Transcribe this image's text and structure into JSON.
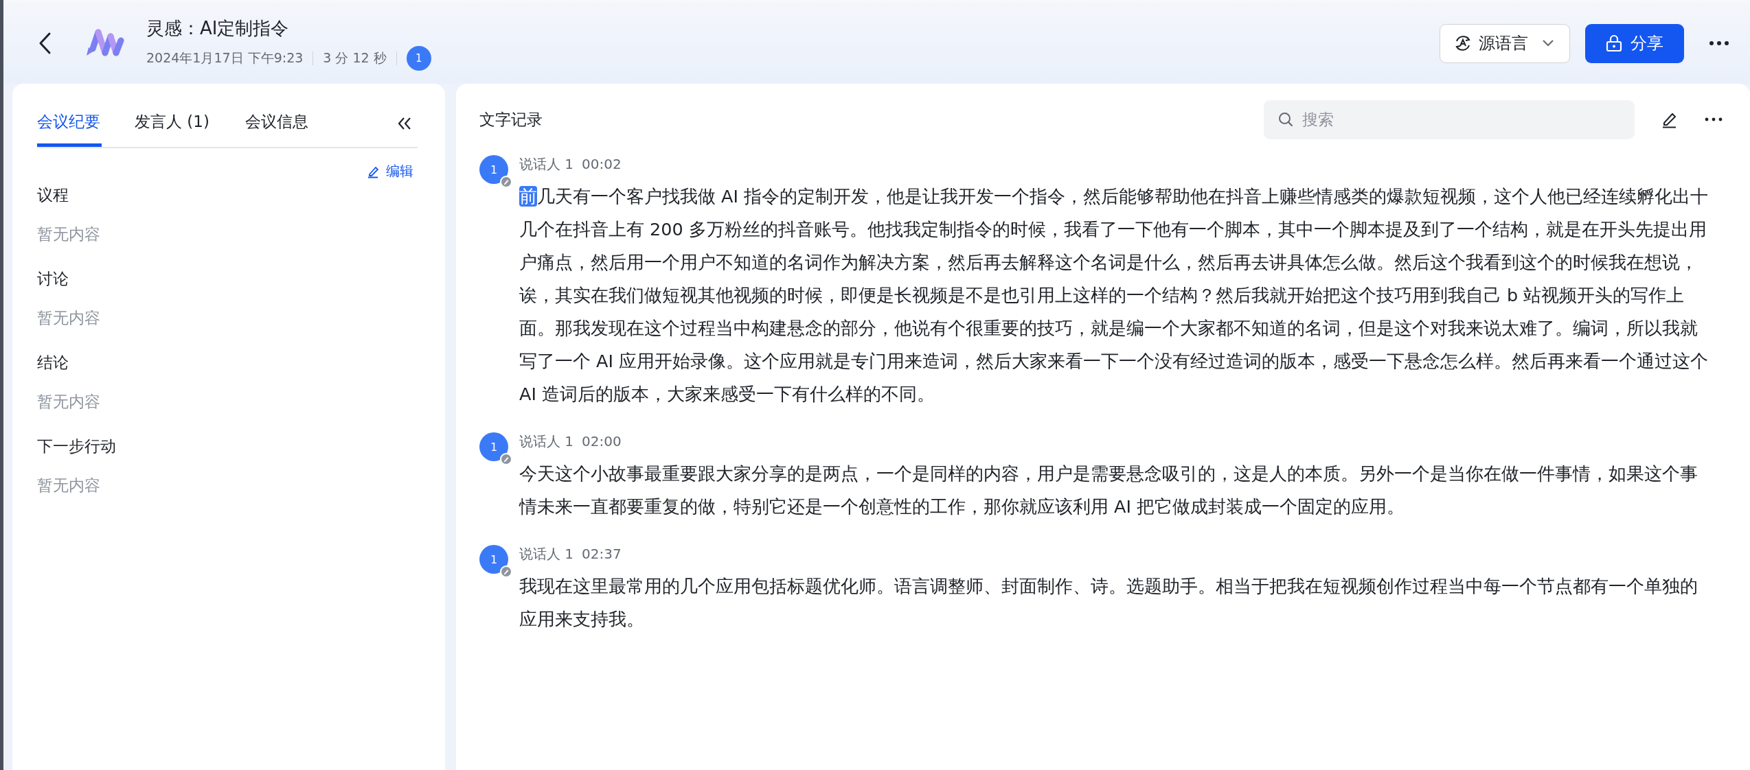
{
  "header": {
    "title": "灵感：AI定制指令",
    "date": "2024年1月17日 下午9:23",
    "duration": "3 分 12 秒",
    "participant_badge": "1",
    "language_button": "源语言",
    "share_button": "分享"
  },
  "left_panel": {
    "tabs": [
      {
        "label": "会议纪要",
        "selected": true
      },
      {
        "label": "发言人 (1)",
        "selected": false
      },
      {
        "label": "会议信息",
        "selected": false
      }
    ],
    "edit_link": "编辑",
    "sections": [
      {
        "heading": "议程",
        "content": "暂无内容"
      },
      {
        "heading": "讨论",
        "content": "暂无内容"
      },
      {
        "heading": "结论",
        "content": "暂无内容"
      },
      {
        "heading": "下一步行动",
        "content": "暂无内容"
      }
    ]
  },
  "transcript": {
    "title": "文字记录",
    "search": {
      "placeholder": "搜索"
    },
    "entries": [
      {
        "avatar": "1",
        "speaker": "说话人 1",
        "time": "00:02",
        "segments": [
          {
            "text": "前",
            "highlighted": true
          },
          {
            "text": "几天有一个客户找我做 AI 指令的定制开发，他是让我开发一个指令，然后能够帮助他在抖音上赚些情感类的爆款短视频，这个人他已经连续孵化出十几个在抖音上有 200 多万粉丝的抖音账号。他找我定制指令的时候，我看了一下他有一个脚本，其中一个脚本提及到了一个结构，就是在开头先提出用户痛点，然后用一个用户不知道的名词作为解决方案，然后再去解释这个名词是什么，然后再去讲具体怎么做。然后这个我看到这个的时候我在想说，诶，其实在我们做短视其他视频的时候，即便是长视频是不是也引用上这样的一个结构？然后我就开始把这个技巧用到我自己 b 站视频开头的写作上面。那我发现在这个过程当中构建悬念的部分，他说有个很重要的技巧，就是编一个大家都不知道的名词，但是这个对我来说太难了。编词，所以我就写了一个 AI 应用开始录像。这个应用就是专门用来造词，然后大家来看一下一个没有经过造词的版本，感受一下悬念怎么样。然后再来看一个通过这个 AI 造词后的版本，大家来感受一下有什么样的不同。",
            "highlighted": false
          }
        ]
      },
      {
        "avatar": "1",
        "speaker": "说话人 1",
        "time": "02:00",
        "segments": [
          {
            "text": "今天这个小故事最重要跟大家分享的是两点，一个是同样的内容，用户是需要悬念吸引的，这是人的本质。另外一个是当你在做一件事情，如果这个事情未来一直都要重复的做，特别它还是一个创意性的工作，那你就应该利用 AI 把它做成封装成一个固定的应用。",
            "highlighted": false
          }
        ]
      },
      {
        "avatar": "1",
        "speaker": "说话人 1",
        "time": "02:37",
        "segments": [
          {
            "text": "我现在这里最常用的几个应用包括标题优化师。语言调整师、封面制作、诗。选题助手。相当于把我在短视频创作过程当中每一个节点都有一个单独的应用来支持我。",
            "highlighted": false
          }
        ]
      }
    ]
  }
}
